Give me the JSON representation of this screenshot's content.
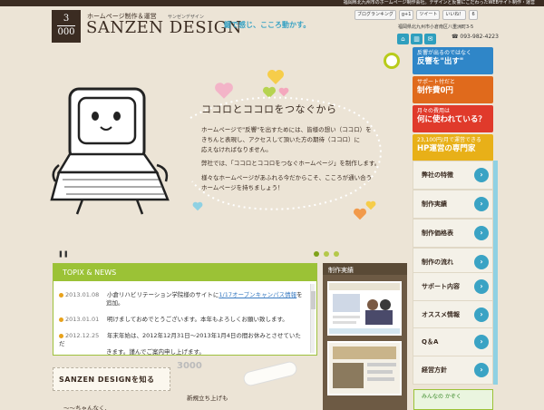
{
  "topbar": {
    "text": "福岡県北九州市のホームページ制作会社。デザインと反響にこだわったWEBサイト制作・運営"
  },
  "logo": {
    "top": "3",
    "bottom": "000"
  },
  "brand": {
    "sub": "ホームページ制作＆運営",
    "kana": "サンゼンデザイン",
    "name": "SANZEN DESIGN",
    "tagline": "鍵で感じ、こころ動かす。"
  },
  "social": {
    "blog": "ブログランキング",
    "gplus": "g+1",
    "tweet": "ツイート",
    "like": "いいね！",
    "count": "6"
  },
  "header": {
    "address": "福岡県北九州市小倉南区八重洲町3-5",
    "tel": "093-982-4223"
  },
  "hero": {
    "title": "ココロとココロをつなぐから",
    "p1a": "ホームページで\"反響\"を出すためには、皆様の想い（ココロ）を",
    "p1b": "きちんと表現し、アクセスして頂いた方の期待（ココロ）に",
    "p1c": "応えなければなりません。",
    "p2": "弊社では、「ココロとココロをつなぐホームページ」を制作します。",
    "p3a": "様々なホームページがあふれる今だからこそ、こころが通い合う",
    "p3b": "ホームページを持ちましょう！"
  },
  "topix": {
    "heading": "TOPIX & NEWS",
    "items": [
      {
        "date": "2013.01.08",
        "text": "小倉リハビリテーション学院様のサイトに",
        "link": "1/17オープンキャンパス情報",
        "after": "を",
        "line2": "追加。"
      },
      {
        "date": "2013.01.01",
        "text": "明けましておめでとうございます。本年もよろしくお願い致します。"
      },
      {
        "date": "2012.12.25",
        "text": "年末年始は、2012年12月31日～2013年1月4日の間お休みとさせていただ",
        "line2": "きます。謹んでご案内申し上げます。"
      }
    ]
  },
  "works": {
    "title": "制作実績"
  },
  "banners": [
    {
      "small": "反響が出るのではなく",
      "big": "反響を\"出す\"",
      "bg": "#2f86c8",
      "fg": "#ffffff"
    },
    {
      "small": "サポート付だと",
      "big": "制作費0円",
      "bg": "#e06a1c",
      "fg": "#ffffff"
    },
    {
      "small": "月々の費用は",
      "big": "何に使われている？",
      "bg": "#e03a2b",
      "fg": "#ffffff"
    },
    {
      "small": "23,100円/月で運営できる",
      "big": "HP運営の専門家",
      "bg": "#e8b018",
      "fg": "#ffffff"
    }
  ],
  "menu": [
    "弊社の特徴",
    "制作実績",
    "制作価格表",
    "制作の流れ",
    "サポート内容",
    "オススメ情報",
    "Q＆A",
    "経営方針"
  ],
  "bottom": {
    "know": "SANZEN DESIGNを知る",
    "numbers": "3000",
    "hand1": "新規立ち上げも",
    "hand2": "〜〜ちゃんなく、",
    "card": "みんなの かぞく"
  }
}
